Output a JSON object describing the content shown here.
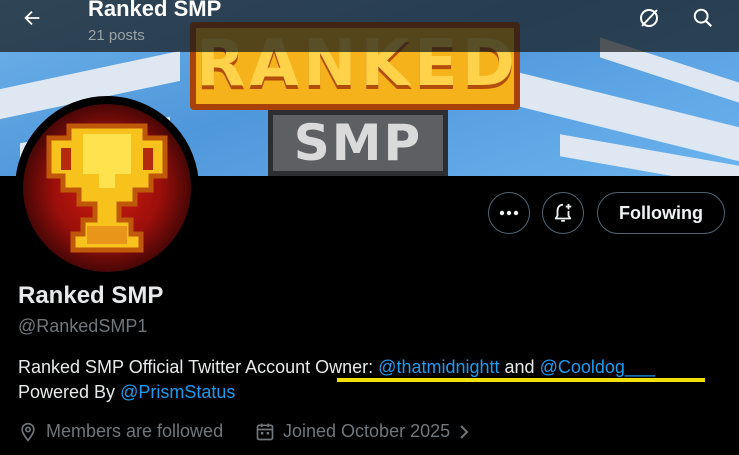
{
  "header": {
    "title": "Ranked SMP",
    "post_count": "21 posts"
  },
  "banner": {
    "title_top": "RANKED",
    "title_bottom": "SMP"
  },
  "actions": {
    "following_label": "Following"
  },
  "profile": {
    "display_name": "Ranked SMP",
    "handle": "@RankedSMP1",
    "bio": {
      "text_1": "Ranked SMP Official Twitter Account ",
      "owner_label": "Owner: ",
      "mention_1": "@thatmidnightt",
      "and_text": " and ",
      "mention_2": "@Cooldog___",
      "powered_text": "Powered By ",
      "mention_3": "@PrismStatus"
    },
    "location": "Members are followed",
    "joined": "Joined October 2025"
  },
  "colors": {
    "link": "#1d9bf0",
    "highlight": "#f2e20b",
    "muted": "#71767b"
  }
}
